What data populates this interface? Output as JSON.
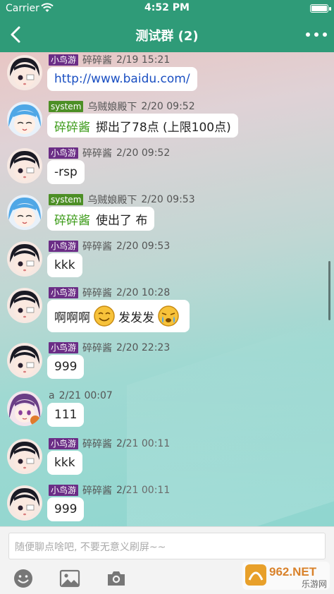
{
  "status_bar": {
    "carrier": "Carrier",
    "time": "4:52 PM"
  },
  "nav": {
    "title": "测试群 (2)"
  },
  "messages": [
    {
      "tag": "小鸟游",
      "sender": "碎碎酱",
      "time": "2/19 15:21",
      "text": "http://www.baidu.com/"
    },
    {
      "tag": "system",
      "sender": "乌贼娘殿下",
      "time": "2/20 09:52",
      "prefix": "碎碎酱",
      "text": "掷出了78点 (上限100点)"
    },
    {
      "tag": "小鸟游",
      "sender": "碎碎酱",
      "time": "2/20 09:52",
      "text": "-rsp"
    },
    {
      "tag": "system",
      "sender": "乌贼娘殿下",
      "time": "2/20 09:53",
      "prefix": "碎碎酱",
      "text": "使出了 布"
    },
    {
      "tag": "小鸟游",
      "sender": "碎碎酱",
      "time": "2/20 09:53",
      "text": "kkk"
    },
    {
      "tag": "小鸟游",
      "sender": "碎碎酱",
      "time": "2/20 10:28",
      "text_a": "啊啊啊",
      "text_b": "发发发"
    },
    {
      "tag": "小鸟游",
      "sender": "碎碎酱",
      "time": "2/20 22:23",
      "text": "999"
    },
    {
      "sender": "a",
      "time": "2/21 00:07",
      "text": "111"
    },
    {
      "tag": "小鸟游",
      "sender": "碎碎酱",
      "time": "2/21 00:11",
      "text": "kkk"
    },
    {
      "tag": "小鸟游",
      "sender": "碎碎酱",
      "time": "2/21 00:11",
      "text": "999"
    }
  ],
  "input": {
    "placeholder": "随便聊点啥吧, 不要无意义刷屏~~"
  },
  "watermark": {
    "main": "962.NET",
    "sub": "乐游网"
  },
  "colors": {
    "nav": "#2f9b78",
    "tag_user": "#6b2d86",
    "tag_system": "#4d8f26",
    "link": "#1a4fc2",
    "prefix": "#3a9a16"
  },
  "icons": [
    "back-arrow-icon",
    "more-dots-icon",
    "emoji-icon",
    "image-icon",
    "camera-icon"
  ]
}
